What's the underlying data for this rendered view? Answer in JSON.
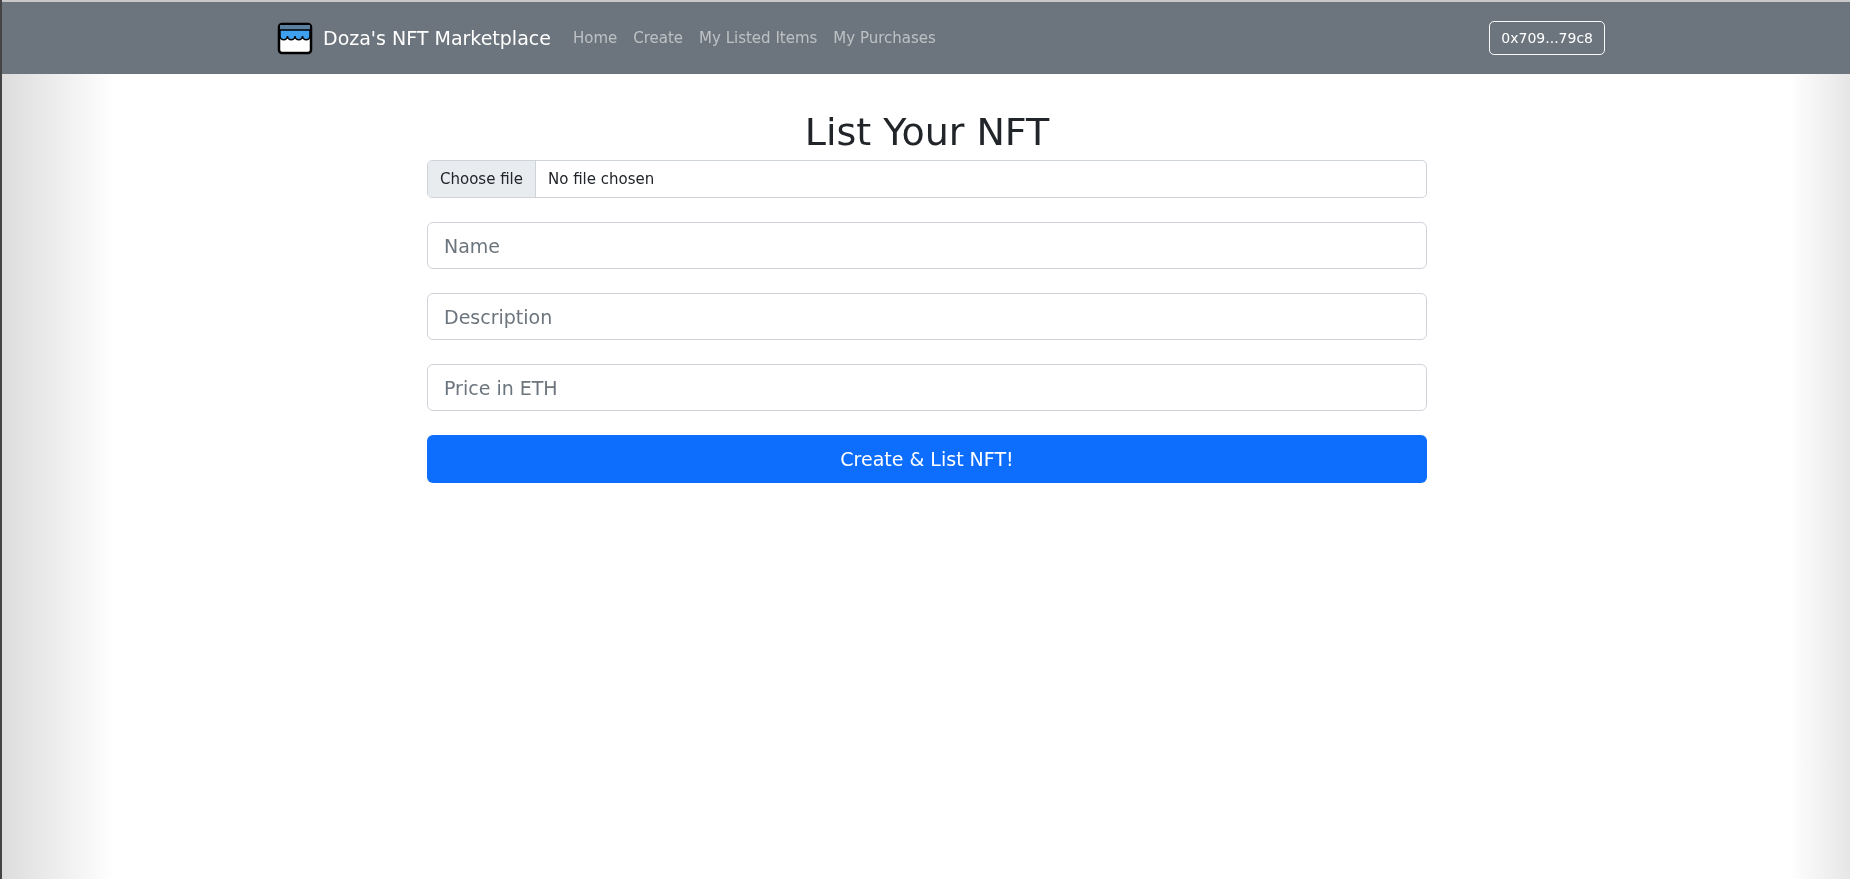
{
  "navbar": {
    "brand": "Doza's NFT Marketplace",
    "links": [
      {
        "label": "Home"
      },
      {
        "label": "Create"
      },
      {
        "label": "My Listed Items"
      },
      {
        "label": "My Purchases"
      }
    ],
    "account": "0x709...79c8"
  },
  "title": "List Your NFT",
  "file_input": {
    "button": "Choose file",
    "status": "No file chosen"
  },
  "fields": [
    {
      "placeholder": "Name"
    },
    {
      "placeholder": "Description"
    },
    {
      "placeholder": "Price in ETH"
    }
  ],
  "submit": "Create & List NFT!"
}
